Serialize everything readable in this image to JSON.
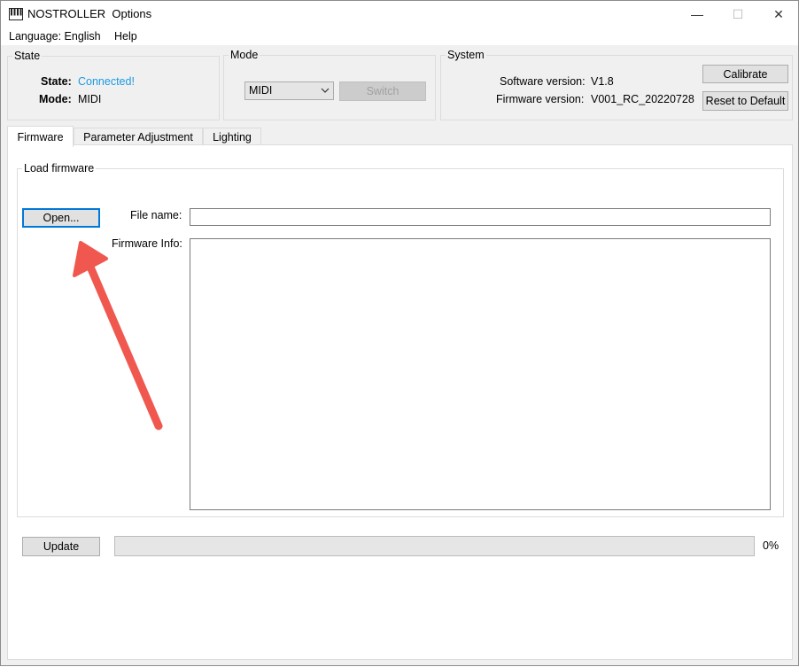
{
  "window": {
    "title": "NOSTROLLER  Options",
    "app_icon": "piano-keys-icon",
    "controls": {
      "minimize": "—",
      "maximize": "☐",
      "close": "✕"
    }
  },
  "menu": {
    "items": [
      {
        "label": "Language: English"
      },
      {
        "label": "Help"
      }
    ]
  },
  "state_group": {
    "legend": "State",
    "state_label": "State:",
    "state_value": "Connected!",
    "state_color": "#1a9ae0",
    "mode_label": "Mode:",
    "mode_value": "MIDI"
  },
  "mode_group": {
    "legend": "Mode",
    "select_value": "MIDI",
    "switch_label": "Switch"
  },
  "system_group": {
    "legend": "System",
    "software_label": "Software version:",
    "software_value": "V1.8",
    "firmware_label": "Firmware version:",
    "firmware_value": "V001_RC_20220728",
    "calibrate_label": "Calibrate",
    "reset_label": "Reset to Default"
  },
  "tabs": [
    {
      "label": "Firmware",
      "active": true
    },
    {
      "label": "Parameter Adjustment",
      "active": false
    },
    {
      "label": "Lighting",
      "active": false
    }
  ],
  "firmware_tab": {
    "group_legend": "Load firmware",
    "open_label": "Open...",
    "file_name_label": "File name:",
    "file_name_value": "",
    "firmware_info_label": "Firmware Info:",
    "firmware_info_value": "",
    "update_label": "Update",
    "progress_fraction": 0,
    "progress_text": "0%"
  },
  "annotation": {
    "arrow_color": "#f0584f",
    "points_to": "open-button"
  }
}
